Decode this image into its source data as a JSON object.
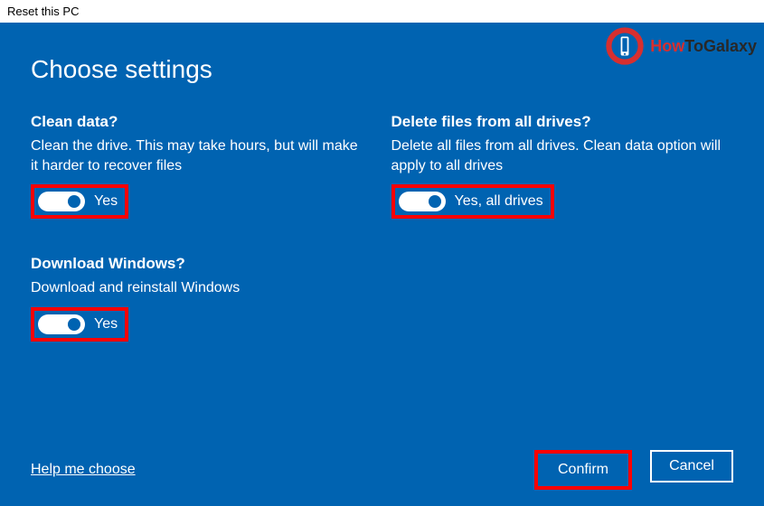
{
  "window_title": "Reset this PC",
  "page_title": "Choose settings",
  "settings": {
    "clean": {
      "title": "Clean data?",
      "desc": "Clean the drive. This may take hours, but will make it harder to recover files",
      "toggle_label": "Yes"
    },
    "delete_all": {
      "title": "Delete files from all drives?",
      "desc": "Delete all files from all drives. Clean data option will apply to all drives",
      "toggle_label": "Yes, all drives"
    },
    "download": {
      "title": "Download Windows?",
      "desc": "Download and reinstall Windows",
      "toggle_label": "Yes"
    }
  },
  "footer": {
    "help": "Help me choose",
    "confirm": "Confirm",
    "cancel": "Cancel"
  },
  "watermark": {
    "how": "How",
    "to": "To",
    "galaxy": "Galaxy"
  }
}
